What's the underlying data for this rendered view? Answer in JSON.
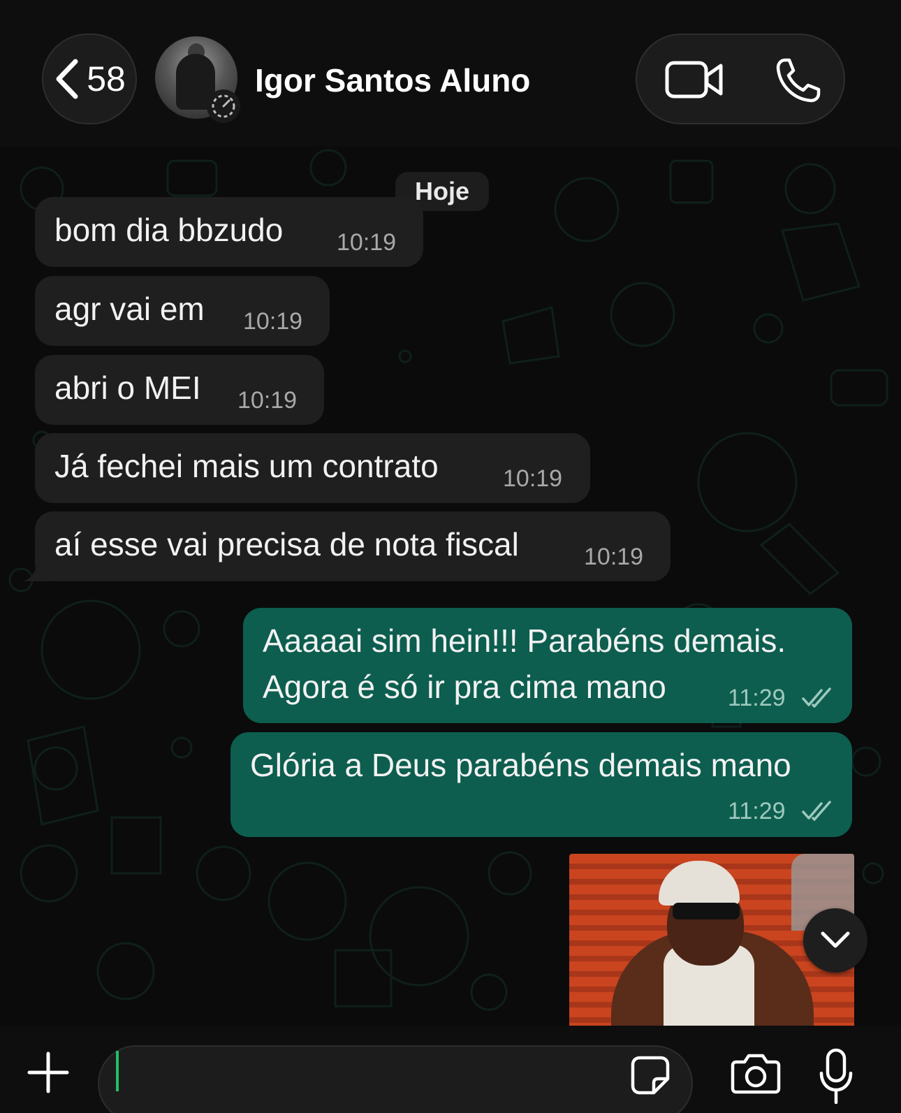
{
  "header": {
    "back_count": "58",
    "contact_name": "Igor Santos Aluno",
    "icons": [
      "chevron-left-icon",
      "status-icon",
      "video-call-icon",
      "phone-icon"
    ]
  },
  "chat": {
    "date_divider": "Hoje",
    "messages": [
      {
        "direction": "incoming",
        "text": "bom dia bbzudo",
        "time": "10:19"
      },
      {
        "direction": "incoming",
        "text": "agr vai em",
        "time": "10:19"
      },
      {
        "direction": "incoming",
        "text": "abri o MEI",
        "time": "10:19"
      },
      {
        "direction": "incoming",
        "text": "Já fechei mais um contrato",
        "time": "10:19"
      },
      {
        "direction": "incoming",
        "text": "aí esse vai precisa de nota fiscal",
        "time": "10:19"
      },
      {
        "direction": "outgoing",
        "text_line1": "Aaaaai sim hein!!! Parabéns demais.",
        "text_line2": "Agora é só ir pra cima mano",
        "time": "11:29",
        "status": "read"
      },
      {
        "direction": "outgoing",
        "text": "Glória a Deus parabéns demais mano",
        "time": "11:29",
        "status": "read"
      }
    ],
    "media_message": {
      "type": "gif",
      "direction": "outgoing"
    }
  },
  "composer": {
    "input_value": "",
    "icons": [
      "plus-icon",
      "sticker-icon",
      "camera-icon",
      "mic-icon"
    ]
  },
  "colors": {
    "incoming_bubble": "#1f1f1f",
    "outgoing_bubble": "#0d5e4f",
    "read_ticks": "#9ec9be",
    "caret": "#21c063"
  }
}
